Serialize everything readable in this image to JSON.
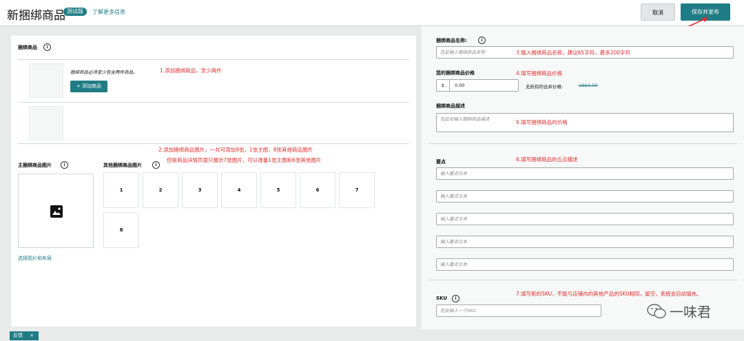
{
  "header": {
    "title": "新捆绑商品",
    "badge": "测试版",
    "learn_more": "了解更多信息",
    "cancel": "取消",
    "save_publish": "保存并发布"
  },
  "left": {
    "bundle_items_label": "捆绑商品",
    "min_two_hint": "捆绑商品必须至少包含两件商品。",
    "add_item_button": "+ 添加商品",
    "main_image_label": "主捆绑商品图片",
    "other_images_label": "其他捆绑商品图片",
    "image_slots": [
      "1",
      "2",
      "3",
      "4",
      "5",
      "6",
      "7",
      "8"
    ],
    "select_images_link": "选择图片和布局"
  },
  "right": {
    "name_label": "捆绑商品名称:",
    "name_placeholder": "在此输入捆绑商品名称",
    "price_label": "您的捆绑商品价格",
    "currency": "$",
    "price_value": "0.00",
    "no_discount_label": "无折扣的合并价格:",
    "no_discount_value": "US$0.00",
    "desc_label": "捆绑商品描述",
    "desc_placeholder": "在此处输入捆绑商品描述",
    "bullets_label": "要点",
    "bullet_placeholders": [
      "输入要点文本",
      "输入要点文本",
      "输入要点文本",
      "输入要点文本",
      "输入要点文本"
    ],
    "sku_label": "SKU",
    "sku_placeholder": "在此输入一个SKU"
  },
  "annotations": {
    "a1": "1.添加捆绑商品，至少两件",
    "a2_line1": "2.添加捆绑商品图片，一共可添加9张，1张主图，8张其他商品图片",
    "a2_line2": "但是商品详情页面只展示7张图片，可以准备1张主图和6张其他图片",
    "a3": "3.输入捆绑商品名称，建议65字符，最多200字符",
    "a4": "4.填写捆绑商品价格",
    "a5": "5.填写捆绑商品的价格",
    "a6": "6.填写捆绑商品的五点描述",
    "a7": "7.填写新的SKU，不能与店铺内的其他产品的SKU相同，留空，系统会自动填充。"
  },
  "footer": {
    "feedback": "反馈",
    "feedback_close": "×"
  },
  "watermark": {
    "text": "一味君"
  },
  "colors": {
    "accent": "#1f7c84",
    "annotation": "#e02b2b",
    "background": "#e9ebeb"
  }
}
